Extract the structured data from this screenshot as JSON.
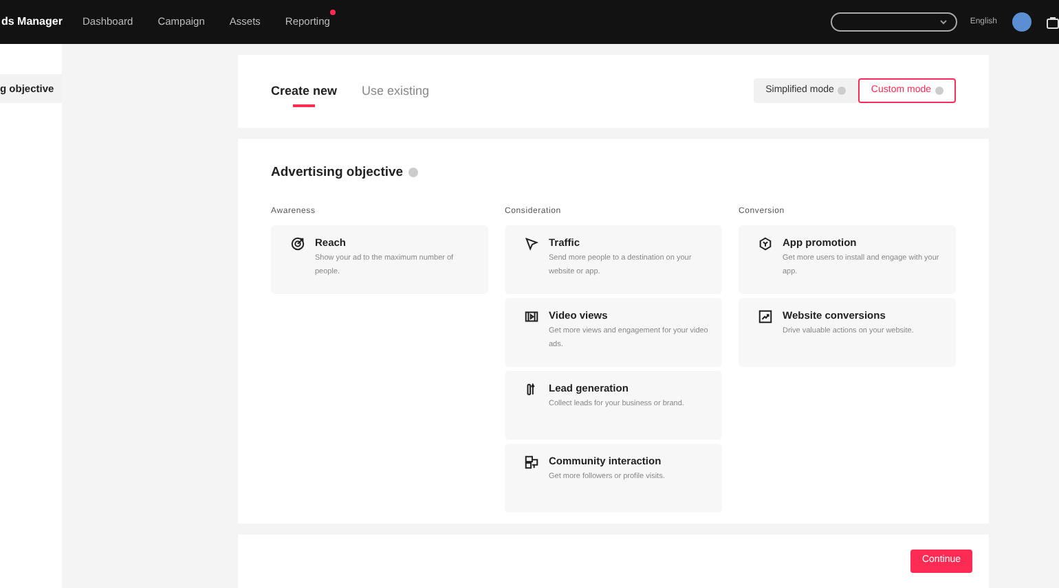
{
  "header": {
    "brand": "ds Manager",
    "nav": [
      {
        "label": "Dashboard",
        "notification": false
      },
      {
        "label": "Campaign",
        "notification": false
      },
      {
        "label": "Assets",
        "notification": false
      },
      {
        "label": "Reporting",
        "notification": true
      }
    ],
    "language": "English"
  },
  "sidebar": {
    "items": [
      {
        "label": "g objective",
        "selected": true
      }
    ]
  },
  "tabs": [
    {
      "label": "Create new",
      "selected": true
    },
    {
      "label": "Use existing",
      "selected": false
    }
  ],
  "modes": [
    {
      "label": "Simplified mode",
      "selected": false
    },
    {
      "label": "Custom mode",
      "selected": true
    }
  ],
  "objective": {
    "title": "Advertising objective",
    "groups": [
      {
        "label": "Awareness",
        "items": [
          {
            "title": "Reach",
            "description": "Show your ad to the maximum number of people."
          }
        ]
      },
      {
        "label": "Consideration",
        "items": [
          {
            "title": "Traffic",
            "description": "Send more people to a destination on your website or app."
          },
          {
            "title": "Video views",
            "description": "Get more views and engagement for your video ads."
          },
          {
            "title": "Lead generation",
            "description": "Collect leads for your business or brand."
          },
          {
            "title": "Community interaction",
            "description": "Get more followers or profile visits."
          }
        ]
      },
      {
        "label": "Conversion",
        "items": [
          {
            "title": "App promotion",
            "description": "Get more users to install and engage with your app."
          },
          {
            "title": "Website conversions",
            "description": "Drive valuable actions on your website."
          }
        ]
      }
    ]
  },
  "footer": {
    "button": "Continue"
  }
}
